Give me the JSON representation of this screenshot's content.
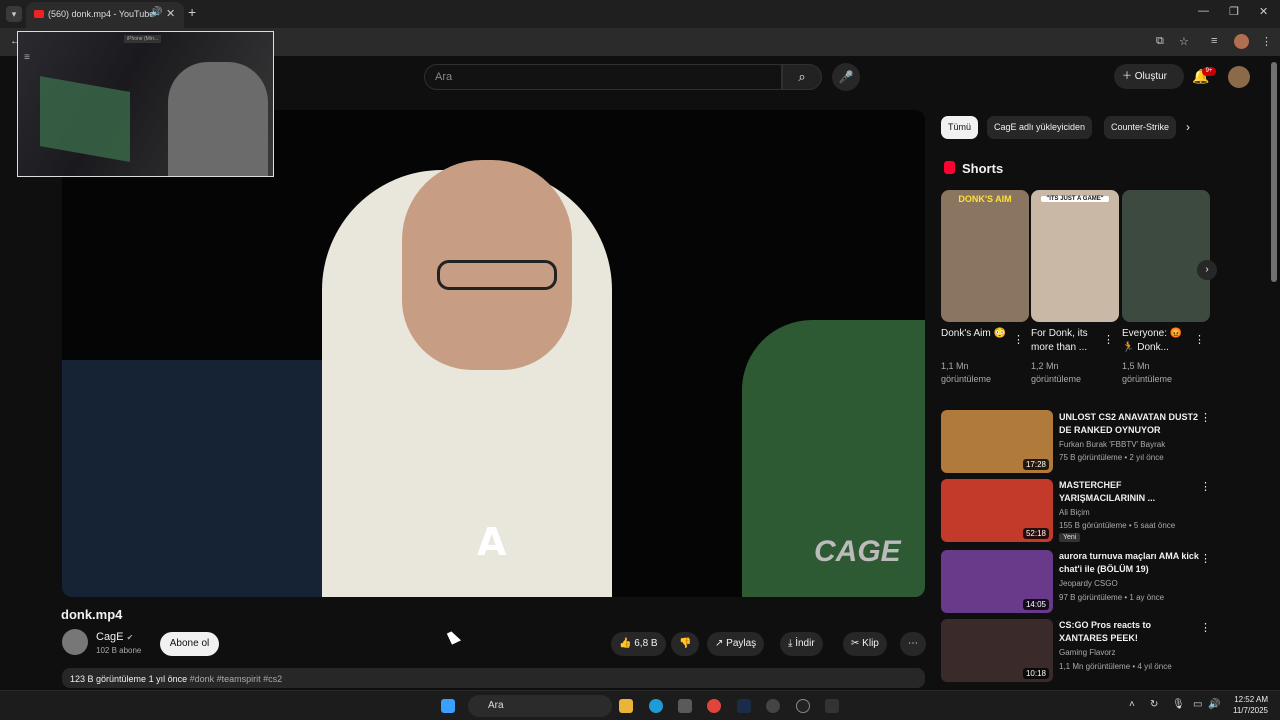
{
  "browser": {
    "tab_title": "(560) donk.mp4 - YouTube",
    "tab_list_icon": "chevron-down-icon",
    "new_tab_icon": "plus-icon"
  },
  "pip": {
    "label": "iPhone (Mirr..."
  },
  "header": {
    "search_placeholder": "Ara",
    "create_label": "Oluştur",
    "notification_badge": "9+"
  },
  "video": {
    "title": "donk.mp4",
    "watermark_letter": "A",
    "watermark_text": "CAGE"
  },
  "channel": {
    "name": "CagE",
    "subscribers": "102 B abone",
    "subscribe_label": "Abone ol"
  },
  "actions": {
    "likes": "6,8 B",
    "share_label": "Paylaş",
    "download_label": "İndir",
    "clip_label": "Klip"
  },
  "description": {
    "views": "123 B görüntüleme",
    "age": "1 yıl önce",
    "tags": "#donk #teamspirit #cs2"
  },
  "chips": [
    "Tümü",
    "CagE adlı yükleyiciden",
    "Counter-Strike"
  ],
  "shorts": {
    "label": "Shorts",
    "items": [
      {
        "caption": "DONK'S AIM",
        "title": "Donk's Aim 😳",
        "views": "1,1 Mn görüntüleme",
        "color": "#8a7560"
      },
      {
        "caption": "\"ITS JUST A GAME\"",
        "title": "For Donk, its more than ...",
        "views": "1,2 Mn görüntüleme",
        "color": "#c9b8a6"
      },
      {
        "caption": "",
        "title": "Everyone: 😡🏃 Donk...",
        "views": "1,5 Mn görüntüleme",
        "color": "#3d4a3f"
      }
    ]
  },
  "recommendations": [
    {
      "title": "UNLOST CS2 ANAVATAN DUST2 DE RANKED OYNUYOR",
      "channel": "Furkan Burak 'FBBTV' Bayrak",
      "meta": "75 B görüntüleme • 2 yıl önce",
      "duration": "17:28",
      "new": "",
      "color": "#b07a3a"
    },
    {
      "title": "MASTERCHEF YARIŞMACILARININ ...",
      "channel": "Ali Biçim",
      "meta": "155 B görüntüleme • 5 saat önce",
      "duration": "52:18",
      "new": "Yeni",
      "color": "#c43a2a"
    },
    {
      "title": "aurora turnuva maçları AMA kick chat'i ile (BÖLÜM 19)",
      "channel": "Jeopardy CSGO",
      "meta": "97 B görüntüleme • 1 ay önce",
      "duration": "14:05",
      "new": "",
      "color": "#6a3a8a"
    },
    {
      "title": "CS:GO Pros reacts to XANTARES PEEK!",
      "channel": "Gaming Flavorz",
      "meta": "1,1 Mn görüntüleme • 4 yıl önce",
      "duration": "10:18",
      "new": "",
      "color": "#3a2a2a"
    }
  ],
  "taskbar": {
    "search_label": "Ara",
    "time": "12:52 AM",
    "date": "11/7/2025"
  }
}
